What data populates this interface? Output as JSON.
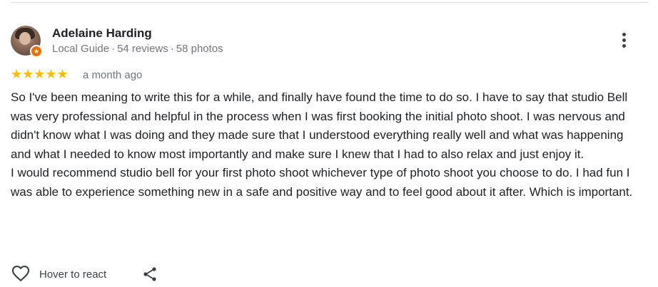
{
  "review": {
    "author": {
      "name": "Adelaine Harding",
      "badge": "Local Guide",
      "reviews": "54 reviews",
      "photos": "58 photos",
      "separator": "·"
    },
    "rating": {
      "stars": 5,
      "max_stars": 5,
      "stars_text": "★★★★★"
    },
    "date": "a month ago",
    "paragraphs": [
      "So I've been meaning to write this for a while, and finally have found the time to do so. I have to say that studio Bell was very professional and helpful in the process when I was first booking the initial photo shoot. I was nervous and didn't know what I was doing and they made sure that I understood everything really well and what was happening and what I needed to know most importantly and make sure I knew that I had to also relax and just enjoy it.",
      "I would recommend studio bell for your first photo shoot whichever type of photo shoot you choose to do. I had fun I was able to experience something new in a safe and positive way and to feel good about it after. Which is important."
    ],
    "actions": {
      "react_label": "Hover to react",
      "like_icon": "heart-outline-icon",
      "share_icon": "share-icon",
      "more_icon": "more-vert-icon"
    }
  },
  "colors": {
    "star": "#fbbc04",
    "text_primary": "#202124",
    "text_secondary": "#70757a",
    "guide_badge": "#e8710a",
    "divider": "#dadce0"
  }
}
